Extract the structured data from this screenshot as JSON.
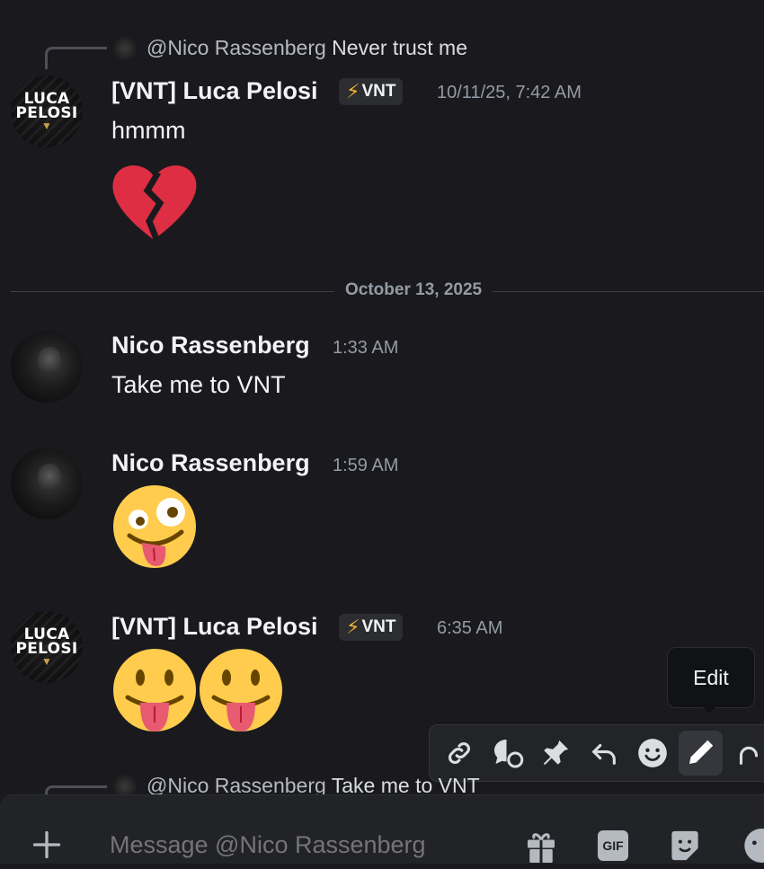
{
  "messages": [
    {
      "reply": {
        "mention": "@Nico Rassenberg",
        "text": "Never trust me"
      },
      "author": "[VNT] Luca Pelosi",
      "badge": "VNT",
      "timestamp": "10/11/25, 7:42 AM",
      "text": "hmmm",
      "emoji": "broken-heart"
    },
    {
      "author": "Nico Rassenberg",
      "timestamp": "1:33 AM",
      "text": "Take me to VNT"
    },
    {
      "author": "Nico Rassenberg",
      "timestamp": "1:59 AM",
      "emoji": "zany-face"
    },
    {
      "author": "[VNT] Luca Pelosi",
      "badge": "VNT",
      "timestamp": "6:35 AM",
      "emoji": [
        "tongue-face",
        "tongue-face"
      ]
    }
  ],
  "date_divider": "October 13, 2025",
  "avatar_logo": {
    "line1": "LUCA",
    "line2": "PELOSI"
  },
  "bottom_reply": {
    "mention": "@Nico Rassenberg",
    "text": "Take me to VNT"
  },
  "tooltip": "Edit",
  "toolbar_icons": [
    "link-icon",
    "thread-icon",
    "pin-icon",
    "reply-icon",
    "emoji-react-icon",
    "pencil-icon",
    "more-icon"
  ],
  "composer": {
    "placeholder": "Message @Nico Rassenberg"
  },
  "composer_icons": [
    "plus-icon",
    "gift-icon",
    "gif-icon",
    "sticker-icon",
    "emoji-icon"
  ],
  "gif_label": "GIF",
  "colors": {
    "background": "#1a1a1e",
    "badge_bolt": "#f0b232",
    "accent": "#5865f2"
  }
}
